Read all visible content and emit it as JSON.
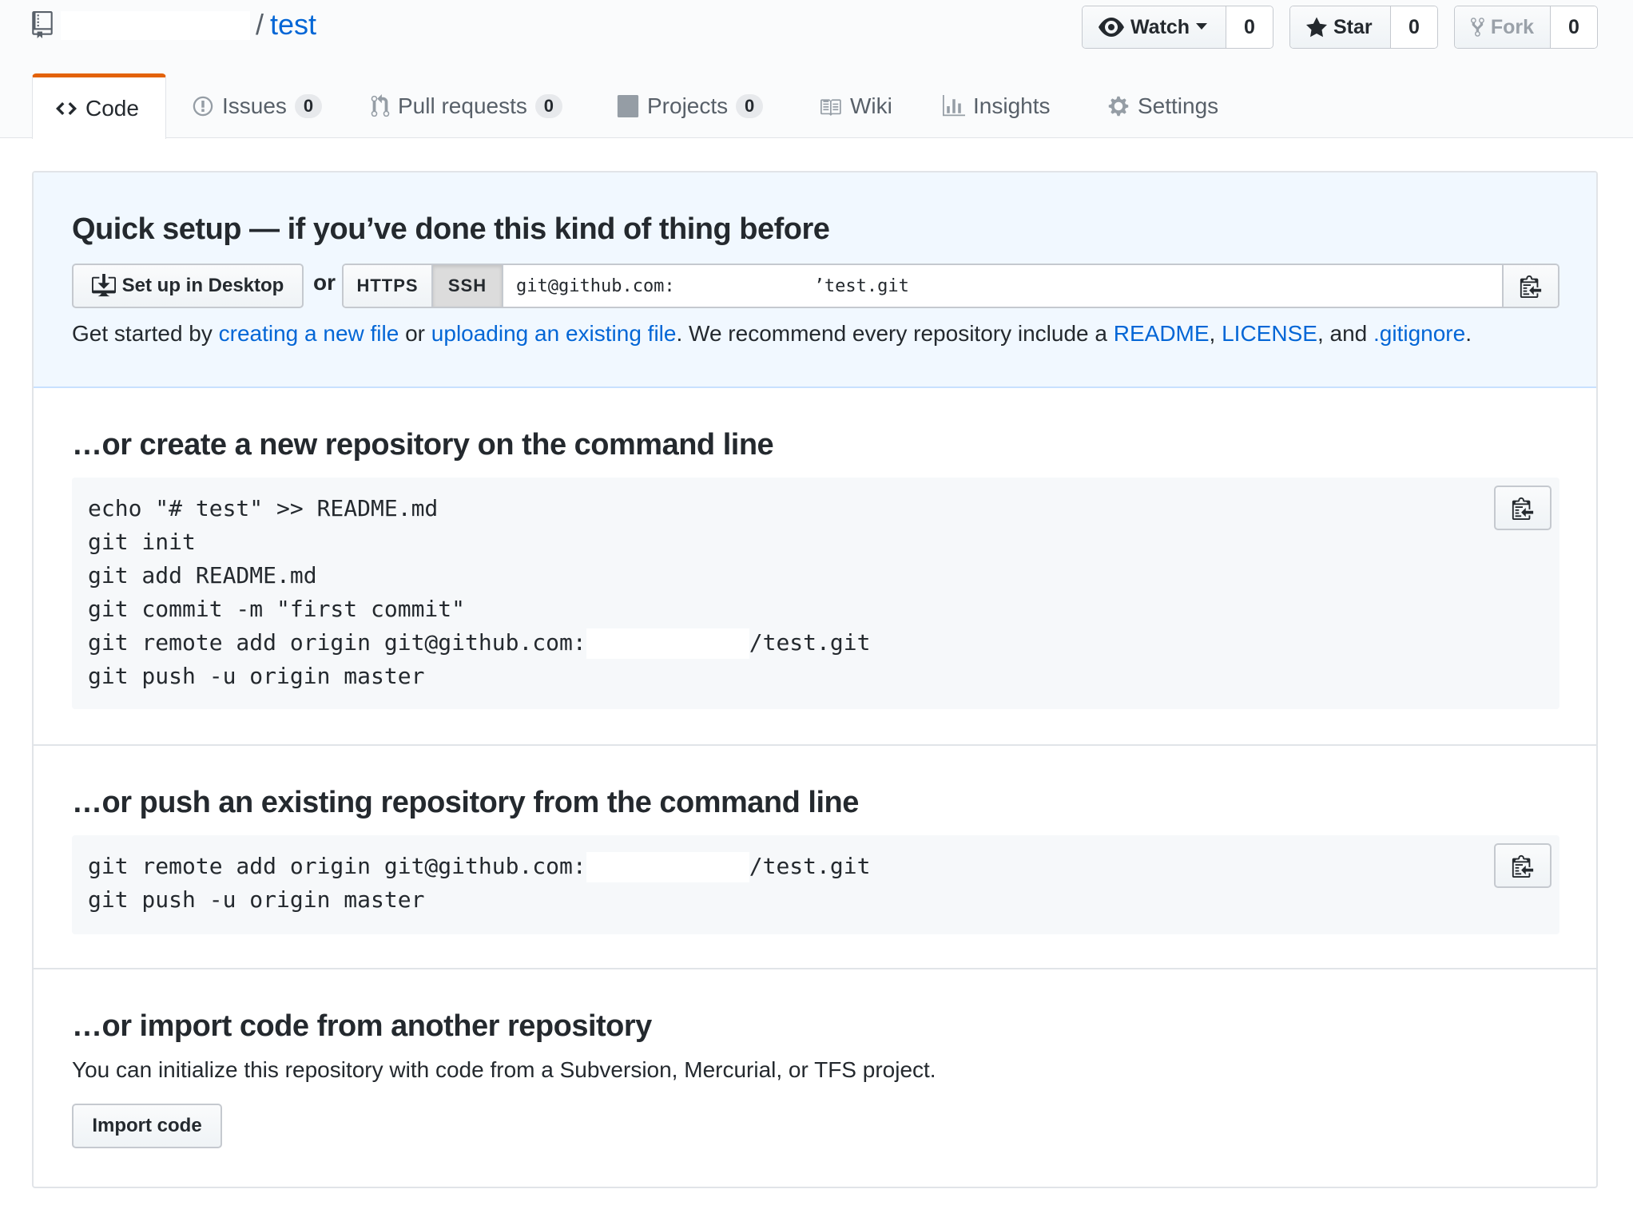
{
  "repo": {
    "owner": "",
    "separator": "/",
    "name": "test"
  },
  "actions": {
    "watch_label": "Watch",
    "watch_count": "0",
    "star_label": "Star",
    "star_count": "0",
    "fork_label": "Fork",
    "fork_count": "0"
  },
  "tabs": [
    {
      "label": "Code",
      "icon": "code-icon",
      "selected": true
    },
    {
      "label": "Issues",
      "icon": "issue-opened-icon",
      "count": "0"
    },
    {
      "label": "Pull requests",
      "icon": "git-pull-request-icon",
      "count": "0"
    },
    {
      "label": "Projects",
      "icon": "project-icon",
      "count": "0"
    },
    {
      "label": "Wiki",
      "icon": "book-icon"
    },
    {
      "label": "Insights",
      "icon": "graph-icon"
    },
    {
      "label": "Settings",
      "icon": "gear-icon"
    }
  ],
  "quick_setup": {
    "title": "Quick setup — if you’ve done this kind of thing before",
    "desktop_button": "Set up in Desktop",
    "or": "or",
    "https_label": "HTTPS",
    "ssh_label": "SSH",
    "url_prefix": "git@github.com:",
    "url_suffix": "’test.git",
    "get_started": {
      "t1": "Get started by ",
      "link1": "creating a new file",
      "t2": " or ",
      "link2": "uploading an existing file",
      "t3": ". We recommend every repository include a ",
      "link3": "README",
      "t4": ", ",
      "link4": "LICENSE",
      "t5": ", and ",
      "link5": ".gitignore",
      "t6": "."
    }
  },
  "create_section": {
    "title": "…or create a new repository on the command line",
    "lines": [
      "echo \"# test\" >> README.md",
      "git init",
      "git add README.md",
      "git commit -m \"first commit\"",
      "git remote add origin git@github.com:",
      "git push -u origin master"
    ],
    "remote_suffix": "/test.git"
  },
  "push_section": {
    "title": "…or push an existing repository from the command line",
    "lines": [
      "git remote add origin git@github.com:",
      "git push -u origin master"
    ],
    "remote_suffix": "/test.git"
  },
  "import_section": {
    "title": "…or import code from another repository",
    "description": "You can initialize this repository with code from a Subversion, Mercurial, or TFS project.",
    "button": "Import code"
  },
  "colors": {
    "link": "#0366d6",
    "tab_accent": "#e36209",
    "quick_setup_bg": "#f1f8ff",
    "code_bg": "#f6f8fa"
  }
}
